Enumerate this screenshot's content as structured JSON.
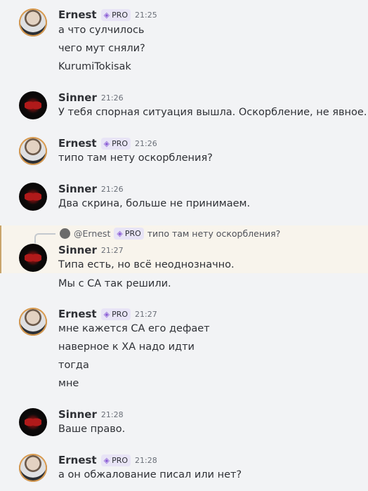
{
  "messages": [
    {
      "author": "Ernest",
      "pro": true,
      "time": "21:25",
      "lines": [
        "а что сулчилось",
        "чего мут сняли?",
        "KurumiTokisak"
      ]
    },
    {
      "author": "Sinner",
      "pro": false,
      "time": "21:26",
      "lines": [
        "У тебя спорная ситуация вышла. Оскорбление, не явное."
      ]
    },
    {
      "author": "Ernest",
      "pro": true,
      "time": "21:26",
      "lines": [
        "типо там нету оскорбления?"
      ]
    },
    {
      "author": "Sinner",
      "pro": false,
      "time": "21:26",
      "lines": [
        "Два скрина,  больше не принимаем."
      ]
    },
    {
      "author": "Sinner",
      "pro": false,
      "time": "21:27",
      "lines": [
        "Типа есть, но всё неоднозначно.",
        "Мы с СА так решили."
      ],
      "reply": {
        "author": "@Ernest",
        "pro": true,
        "text": "типо там нету оскорбления?"
      }
    },
    {
      "author": "Ernest",
      "pro": true,
      "time": "21:27",
      "lines": [
        "мне кажется СА его дефает",
        "наверное к ХА надо идти",
        "тогда",
        "мне"
      ]
    },
    {
      "author": "Sinner",
      "pro": false,
      "time": "21:28",
      "lines": [
        "Ваше право."
      ]
    },
    {
      "author": "Ernest",
      "pro": true,
      "time": "21:28",
      "lines": [
        "а он обжалование писал или нет?"
      ]
    }
  ],
  "badge_label": "PRO",
  "colors": {
    "background": "#f2f3f5",
    "highlight": "#f8f4ec",
    "highlight_border": "#c9a56b",
    "pro_badge": "#e8e4f6"
  }
}
